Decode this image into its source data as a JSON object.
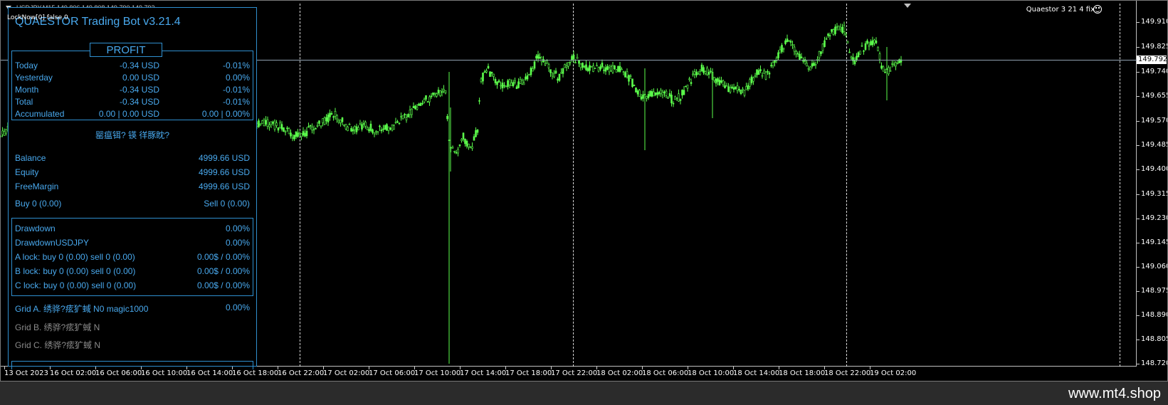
{
  "chart_window": {
    "title": "USDJPY,M15  149.806 149.808 149.790 149.792",
    "lock_label": "LockNow[0]  false  0",
    "ea_label": "Quaestor 3 21 4 fix",
    "current_price": "149.792",
    "price_ticks": [
      "149.910",
      "149.825",
      "149.740",
      "149.655",
      "149.570",
      "149.485",
      "149.400",
      "149.315",
      "149.230",
      "149.145",
      "149.060",
      "148.975",
      "148.890",
      "148.805",
      "148.720"
    ],
    "time_ticks": [
      "13 Oct 2023",
      "16 Oct 02:00",
      "16 Oct 06:00",
      "16 Oct 10:00",
      "16 Oct 14:00",
      "16 Oct 18:00",
      "16 Oct 22:00",
      "17 Oct 02:00",
      "17 Oct 06:00",
      "17 Oct 10:00",
      "17 Oct 14:00",
      "17 Oct 18:00",
      "17 Oct 22:00",
      "18 Oct 02:00",
      "18 Oct 06:00",
      "18 Oct 10:00",
      "18 Oct 14:00",
      "18 Oct 18:00",
      "18 Oct 22:00",
      "19 Oct 02:00"
    ],
    "candle_color": "#5cff4c"
  },
  "panel": {
    "title": "QUAESTOR Trading Bot v3.21.4",
    "profit_header": "PROFIT",
    "profit_rows": [
      {
        "label": "Today",
        "amount": "-0.34 USD",
        "percent": "-0.01%"
      },
      {
        "label": "Yesterday",
        "amount": "0.00 USD",
        "percent": "0.00%"
      },
      {
        "label": "Month",
        "amount": "-0.34 USD",
        "percent": "-0.01%"
      },
      {
        "label": "Total",
        "amount": "-0.34 USD",
        "percent": "-0.01%"
      },
      {
        "label": "Accumulated",
        "amount": "0.00 | 0.00 USD",
        "percent": "0.00 | 0.00%"
      }
    ],
    "garbled_status": "罂瘟铒? 锳 徉豚眈?",
    "balance": {
      "label": "Balance",
      "value": "4999.66 USD"
    },
    "equity": {
      "label": "Equity",
      "value": "4999.66 USD"
    },
    "free_margin": {
      "label": "FreeMargin",
      "value": "4999.66 USD"
    },
    "buy": "Buy 0   (0.00)",
    "sell": "Sell 0   (0.00)",
    "drawdown_rows": [
      {
        "label": "Drawdown",
        "value": "0.00%"
      },
      {
        "label": "DrawdownUSDJPY",
        "value": "0.00%"
      },
      {
        "label": "A lock: buy 0 (0.00) sell 0 (0.00)",
        "value": "0.00$ / 0.00%"
      },
      {
        "label": "B lock: buy 0 (0.00) sell 0 (0.00)",
        "value": "0.00$ / 0.00%"
      },
      {
        "label": "C lock: buy 0 (0.00) sell 0 (0.00)",
        "value": "0.00$ / 0.00%"
      }
    ],
    "grid_a": {
      "label": "Grid A. 绣骅?痃犷蜮 N0 magic1000",
      "value": "0.00%"
    },
    "grid_b": "Grid B.  绣骅?痃犷蜮 N",
    "grid_c": "Grid C.  绣骅?痃犷蜮 N"
  },
  "watermark": "www.mt4.shop"
}
